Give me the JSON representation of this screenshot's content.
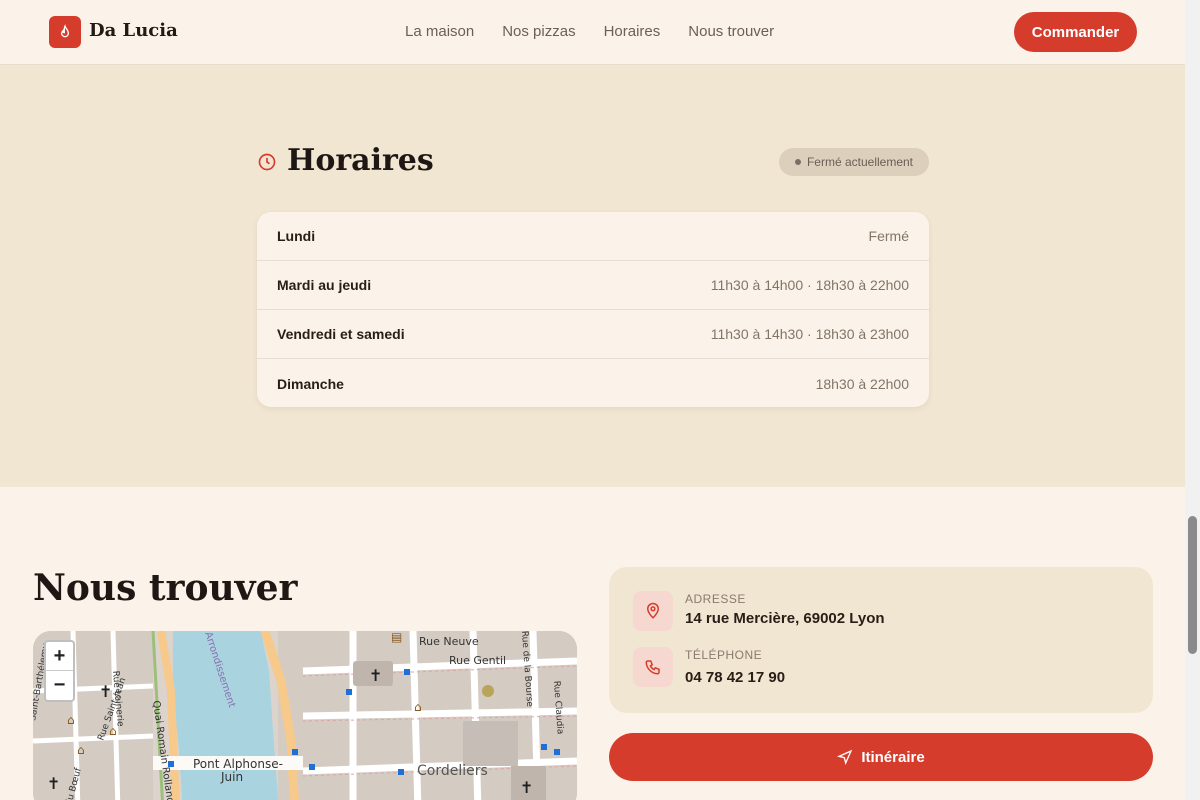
{
  "header": {
    "brand": "Da Lucia",
    "nav": [
      "La maison",
      "Nos pizzas",
      "Horaires",
      "Nous trouver"
    ],
    "cta": "Commander"
  },
  "hours": {
    "title": "Horaires",
    "status": "Fermé actuellement",
    "rows": [
      {
        "day": "Lundi",
        "time": "Fermé"
      },
      {
        "day": "Mardi au jeudi",
        "time": "11h30 à 14h00 · 18h30 à 22h00"
      },
      {
        "day": "Vendredi et samedi",
        "time": "11h30 à 14h30 · 18h30 à 23h00"
      },
      {
        "day": "Dimanche",
        "time": "18h30 à 22h00"
      }
    ]
  },
  "find": {
    "title": "Nous trouver",
    "map": {
      "labels": [
        "Pont Alphonse-",
        "Juin",
        "Cordeliers",
        "Rue Neuve",
        "Rue Gentil",
        "Quai Romain Rolland",
        "Rue de la Bourse",
        "Rue Claudia",
        "Arrondissement",
        "Rue Lainerie",
        "Rue Saint-Jean",
        "Saint-Barthélemy",
        "du Bœuf"
      ],
      "zoom_in": "+",
      "zoom_out": "−"
    },
    "address_label": "ADRESSE",
    "address": "14 rue Mercière, 69002 Lyon",
    "phone_label": "TÉLÉPHONE",
    "phone": "04 78 42 17 90",
    "route": "Itinéraire"
  },
  "colors": {
    "accent": "#d63c2c",
    "bg_light": "#fbf3e9",
    "bg_section": "#f1e6d2"
  }
}
